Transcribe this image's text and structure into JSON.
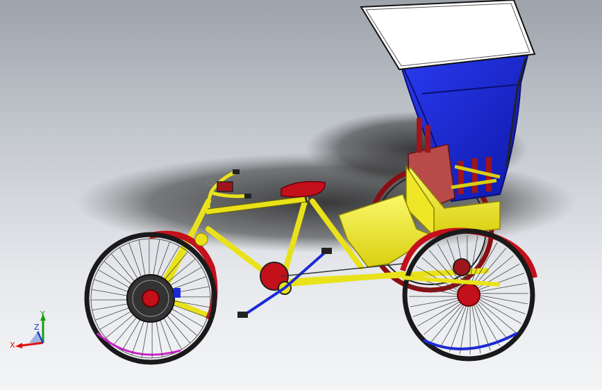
{
  "view": {
    "background_top": "#9ea3ab",
    "background_bottom": "#f4f5f7"
  },
  "model": {
    "frame_color": "#f7f02a",
    "canopy_color": "#1a2ad8",
    "roof_color": "#ffffff",
    "fender_color": "#c4101a",
    "seat_color": "#b81a22",
    "crank_color": "#1a2ad8"
  },
  "triad": {
    "x_label": "X",
    "y_label": "Y",
    "z_label": "Z",
    "x_color": "#e01010",
    "y_color": "#10a010",
    "z_color": "#1030d0"
  }
}
